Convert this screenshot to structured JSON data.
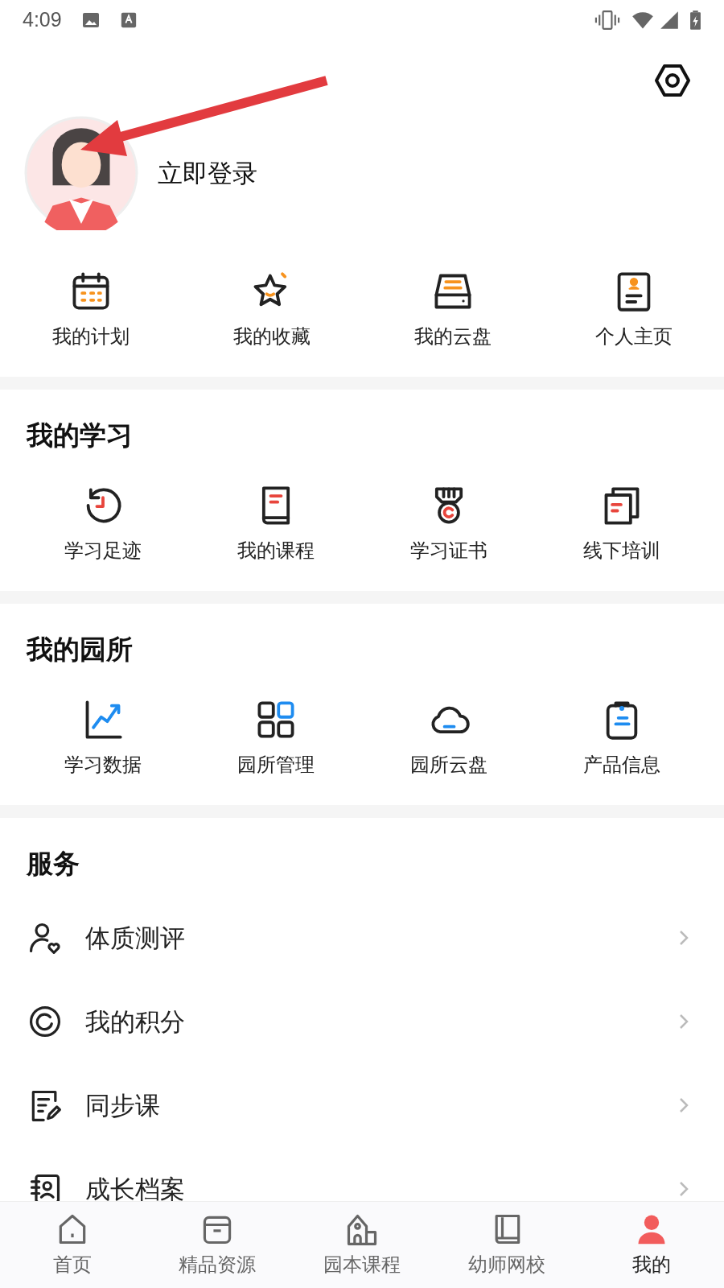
{
  "status_bar": {
    "time": "4:09"
  },
  "profile": {
    "login_label": "立即登录"
  },
  "quick_links": [
    {
      "label": "我的计划"
    },
    {
      "label": "我的收藏"
    },
    {
      "label": "我的云盘"
    },
    {
      "label": "个人主页"
    }
  ],
  "sections": [
    {
      "title": "我的学习",
      "items": [
        {
          "label": "学习足迹"
        },
        {
          "label": "我的课程"
        },
        {
          "label": "学习证书"
        },
        {
          "label": "线下培训"
        }
      ]
    },
    {
      "title": "我的园所",
      "items": [
        {
          "label": "学习数据"
        },
        {
          "label": "园所管理"
        },
        {
          "label": "园所云盘"
        },
        {
          "label": "产品信息"
        }
      ]
    }
  ],
  "services": {
    "title": "服务",
    "items": [
      {
        "label": "体质测评"
      },
      {
        "label": "我的积分"
      },
      {
        "label": "同步课"
      },
      {
        "label": "成长档案"
      }
    ]
  },
  "bottom_nav": [
    {
      "label": "首页",
      "selected": false
    },
    {
      "label": "精品资源",
      "selected": false
    },
    {
      "label": "园本课程",
      "selected": false
    },
    {
      "label": "幼师网校",
      "selected": false
    },
    {
      "label": "我的",
      "selected": true
    }
  ]
}
